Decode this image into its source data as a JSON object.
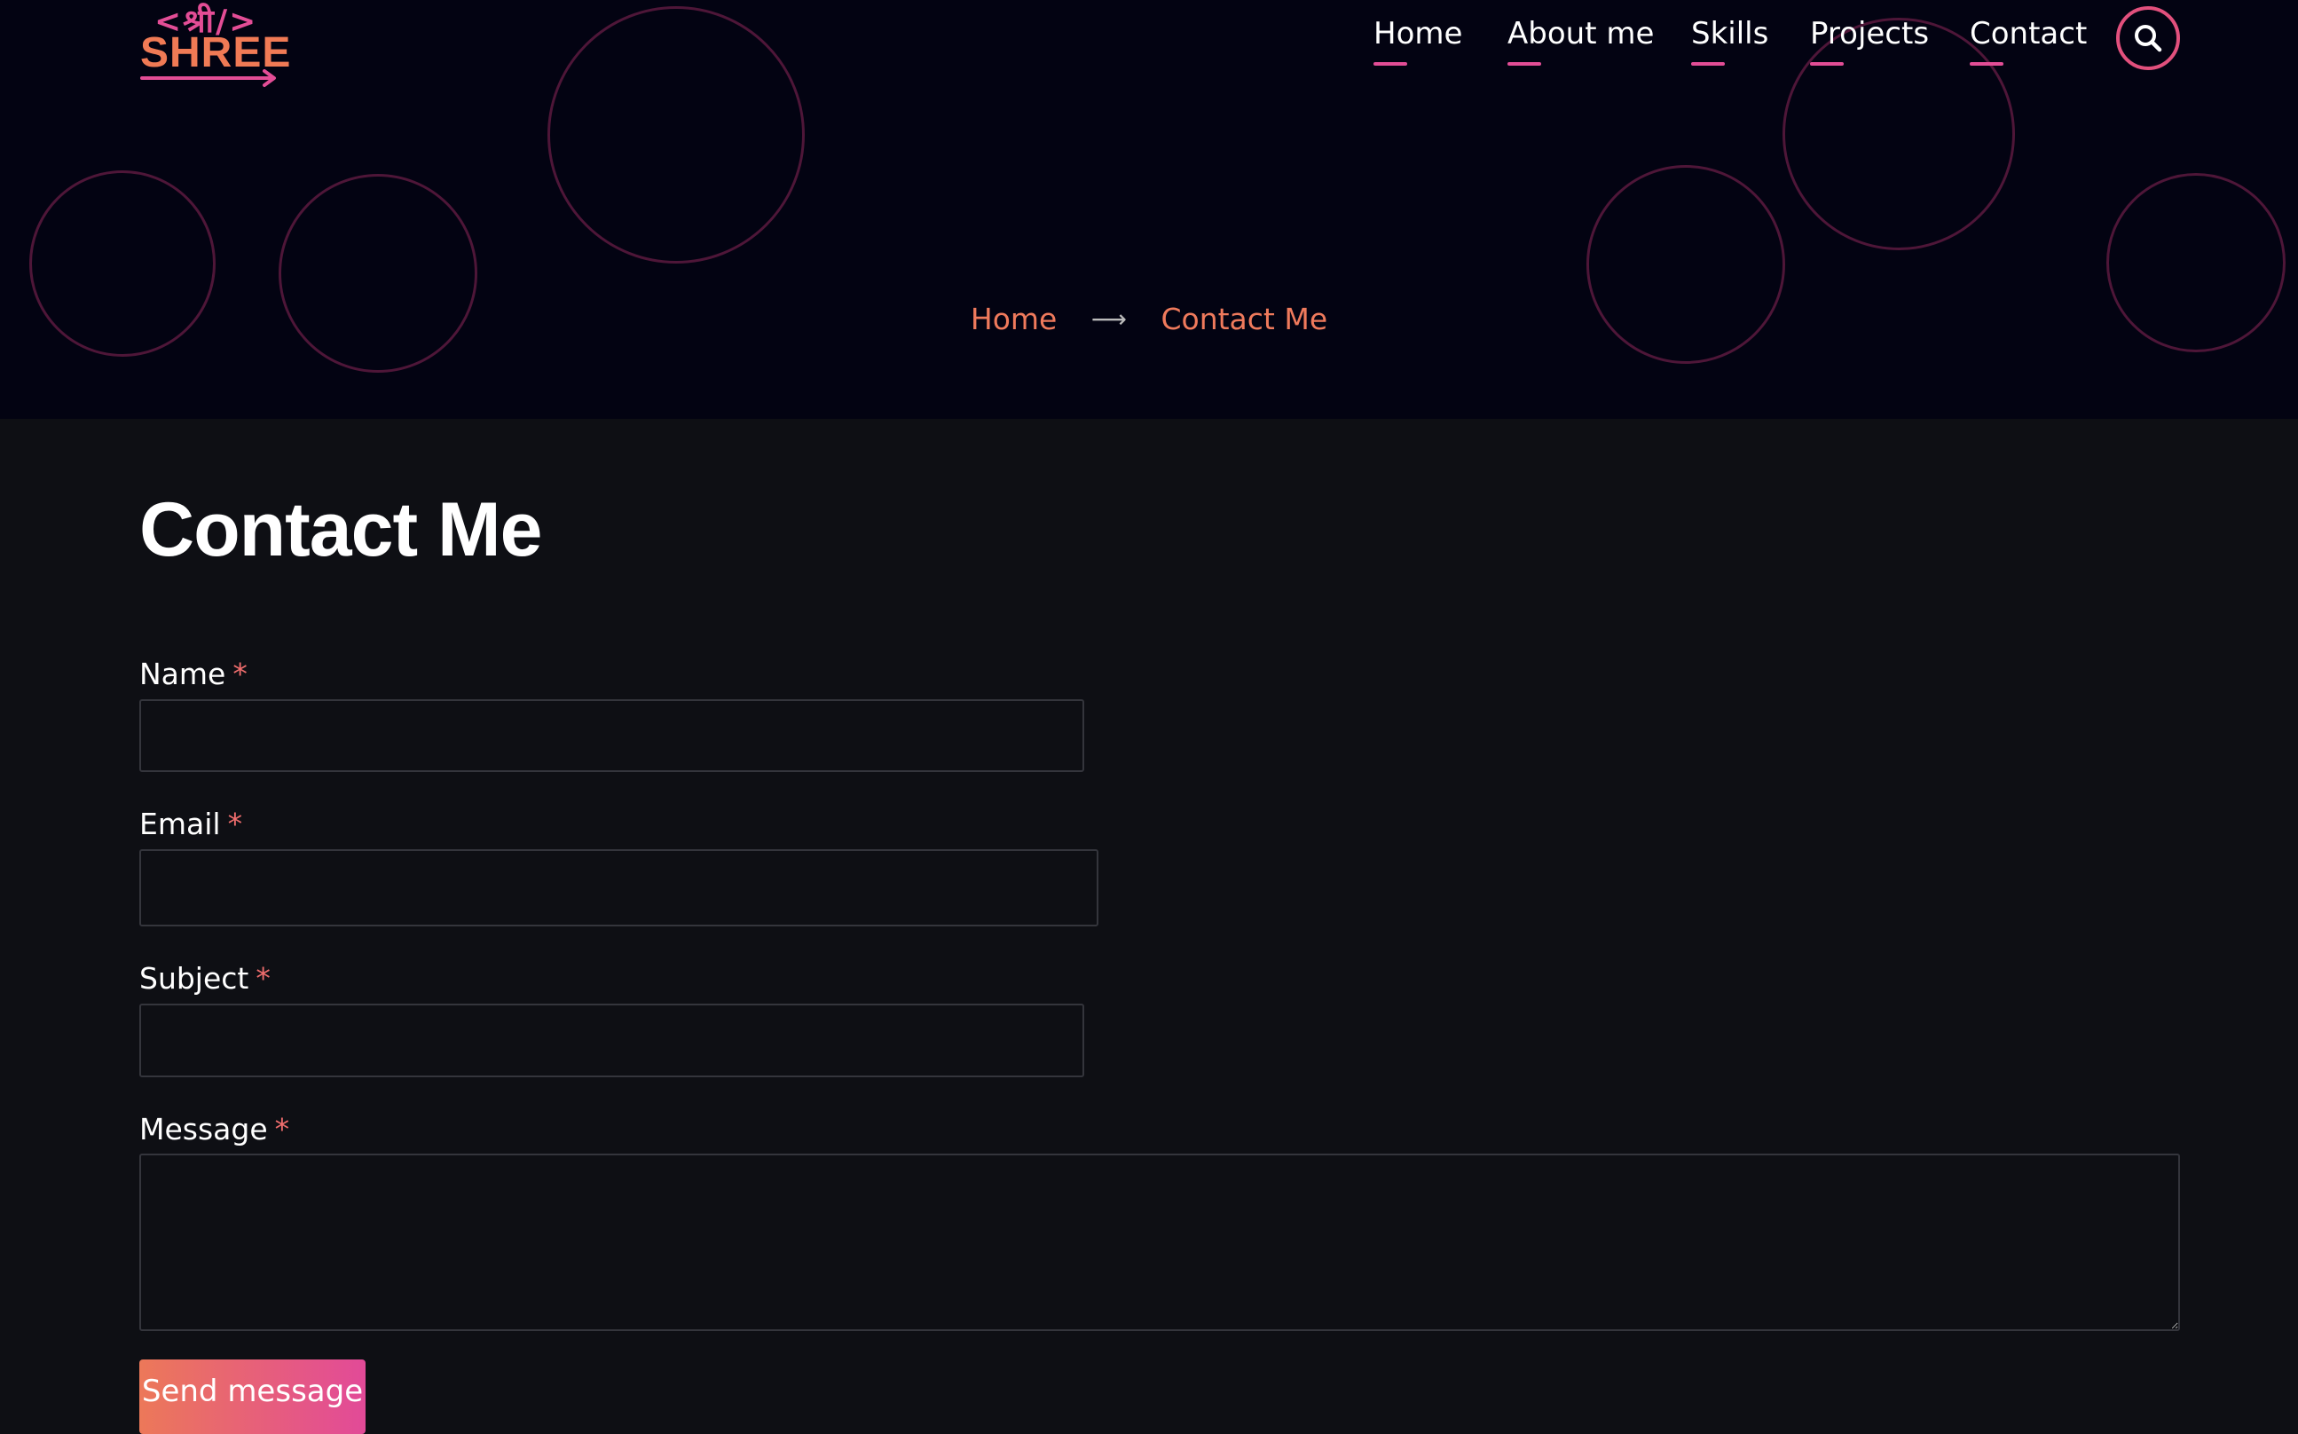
{
  "logo": {
    "top_text": "<श्री/>",
    "word": "SHREE"
  },
  "nav": {
    "items": [
      {
        "label": "Home"
      },
      {
        "label": "About me"
      },
      {
        "label": "Skills"
      },
      {
        "label": "Projects"
      },
      {
        "label": "Contact"
      }
    ],
    "search_icon": "search-icon"
  },
  "breadcrumb": {
    "home": "Home",
    "separator": "⟶",
    "current": "Contact Me"
  },
  "page": {
    "title": "Contact Me"
  },
  "form": {
    "name": {
      "label": "Name",
      "required": "*",
      "value": ""
    },
    "email": {
      "label": "Email",
      "required": "*",
      "value": ""
    },
    "subject": {
      "label": "Subject",
      "required": "*",
      "value": ""
    },
    "message": {
      "label": "Message",
      "required": "*",
      "value": ""
    },
    "submit_label": "Send message"
  },
  "colors": {
    "background": "#0e0f14",
    "hero": "#030312",
    "accent_pink": "#e34d96",
    "accent_orange": "#ef7a5c",
    "bubble_outline": "#4e1638"
  }
}
